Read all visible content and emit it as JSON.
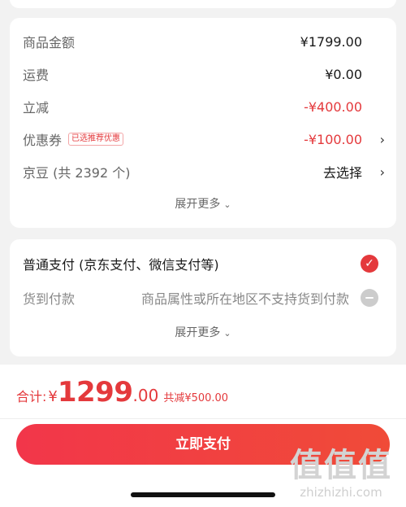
{
  "summary": {
    "rows": [
      {
        "label": "商品金额",
        "value": "¥1799.00"
      },
      {
        "label": "运费",
        "value": "¥0.00"
      },
      {
        "label": "立减",
        "value": "-¥400.00"
      },
      {
        "label": "优惠券",
        "tag": "已选推荐优惠",
        "value": "-¥100.00"
      },
      {
        "label": "京豆 (共 2392 个)",
        "value": "去选择"
      }
    ],
    "expand_label": "展开更多",
    "expand_icon": "chevron-down-icon"
  },
  "payment": {
    "options": [
      {
        "label": "普通支付 (京东支付、微信支付等)",
        "selected": true
      },
      {
        "label": "货到付款",
        "note": "商品属性或所在地区不支持货到付款",
        "disabled": true
      }
    ],
    "expand_label": "展开更多"
  },
  "footer": {
    "total_label": "合计:",
    "currency": "¥",
    "total_int": "1299",
    "total_dec": ".00",
    "discount": "共减¥500.00",
    "pay_button": "立即支付"
  },
  "watermark": {
    "logo": "值值值",
    "url": "zhizhizhi.com"
  },
  "colors": {
    "accent": "#e4393c",
    "background": "#f2f2f2"
  }
}
